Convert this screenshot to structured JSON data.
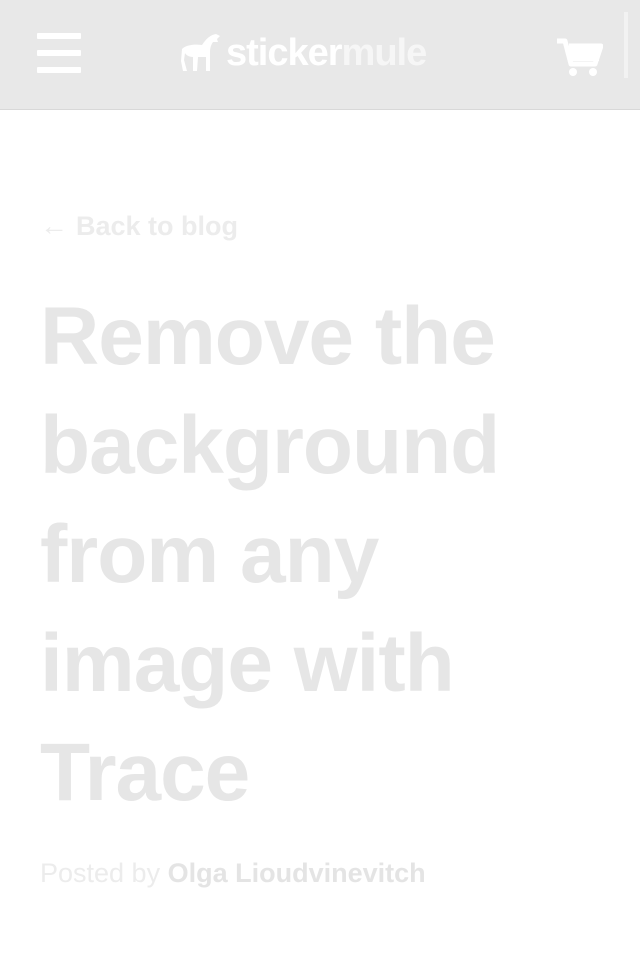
{
  "header": {
    "logo": {
      "part_a": "sticker",
      "part_b": "mule"
    },
    "menu_icon": "hamburger-menu-icon",
    "cart_icon": "shopping-cart-icon"
  },
  "article": {
    "back_arrow": "←",
    "back_label": "Back to blog",
    "title": "Remove the background from any image with Trace",
    "byline_prefix": "Posted by",
    "author": "Olga Lioudvinevitch"
  },
  "colors": {
    "header_bg": "#e8e8e8",
    "overlay_text": "#e6e6e6",
    "page_bg": "#ffffff"
  }
}
